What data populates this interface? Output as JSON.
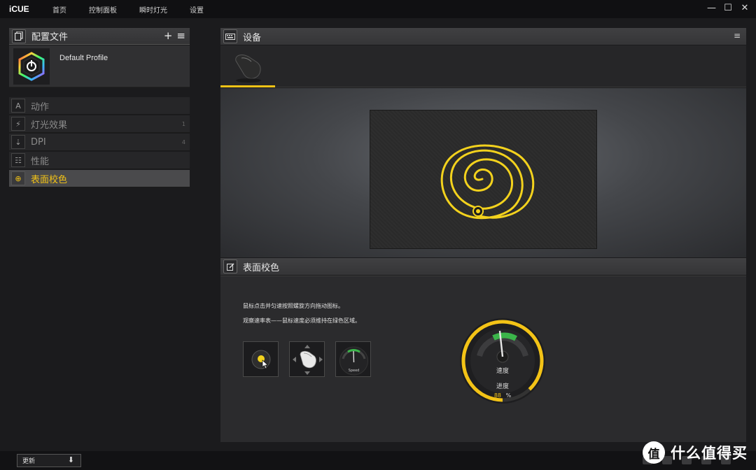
{
  "app": {
    "brand": "iCUE",
    "nav": [
      "首页",
      "控制面板",
      "瞬时灯光",
      "设置"
    ],
    "window_controls": [
      "✕",
      "☐",
      "—"
    ]
  },
  "profiles": {
    "title": "配置文件",
    "add_glyph": "+",
    "menu_glyph": "≡",
    "active_profile": "Default Profile"
  },
  "menu": {
    "items": [
      {
        "label": "动作",
        "icon": "A",
        "count": ""
      },
      {
        "label": "灯光效果",
        "icon": "⚡",
        "count": "1"
      },
      {
        "label": "DPI",
        "icon": "⇣",
        "count": "4"
      },
      {
        "label": "性能",
        "icon": "☷",
        "count": ""
      },
      {
        "label": "表面校色",
        "icon": "⊕",
        "count": ""
      }
    ],
    "active_index": 4
  },
  "device": {
    "title": "设备",
    "menu_glyph": "≡"
  },
  "calibration": {
    "title": "表面校色",
    "instruction_1": "鼠标点击并匀速按照螺旋方向拖动图标。",
    "instruction_2": "观察速率表——鼠标速度必须维持在绿色区域。",
    "speed_tile_label": "Speed",
    "gauge_label": "速度",
    "progress_label": "进度",
    "progress_value": 88,
    "progress_unit": "%",
    "colors": {
      "accent": "#f3c316",
      "green": "#3bb54a"
    }
  },
  "bottom": {
    "update_label": "更新",
    "download_glyph": "⬇"
  },
  "watermark": {
    "logo": "值",
    "text": "什么值得买"
  }
}
